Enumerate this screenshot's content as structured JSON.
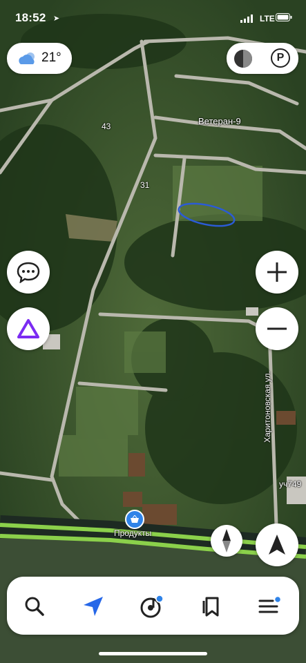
{
  "status_bar": {
    "time": "18:52",
    "network": "LTE"
  },
  "weather": {
    "temperature": "21°",
    "icon": "cloud-sun-icon"
  },
  "top_right": {
    "layers_icon": "layers-icon",
    "parking_label": "P"
  },
  "map_labels": {
    "settlement": "Ветеран-9",
    "road_43": "43",
    "road_31": "31",
    "street": "Харитоновская ул.",
    "plot": "уч749",
    "poi": "Продукты"
  },
  "controls": {
    "chat_icon": "chat-icon",
    "alice_icon": "alice-icon",
    "zoom_in": "+",
    "zoom_out": "−",
    "compass_icon": "compass-icon",
    "location_icon": "location-arrow-icon"
  },
  "bottom_nav": [
    {
      "icon": "search-icon"
    },
    {
      "icon": "navigation-icon"
    },
    {
      "icon": "music-icon"
    },
    {
      "icon": "bookmarks-icon"
    },
    {
      "icon": "menu-icon"
    }
  ],
  "colors": {
    "accent": "#2667e8",
    "alice": "#7b2bf2",
    "road_highlight": "#8bd04b",
    "water_marker": "#2b5bd6"
  }
}
